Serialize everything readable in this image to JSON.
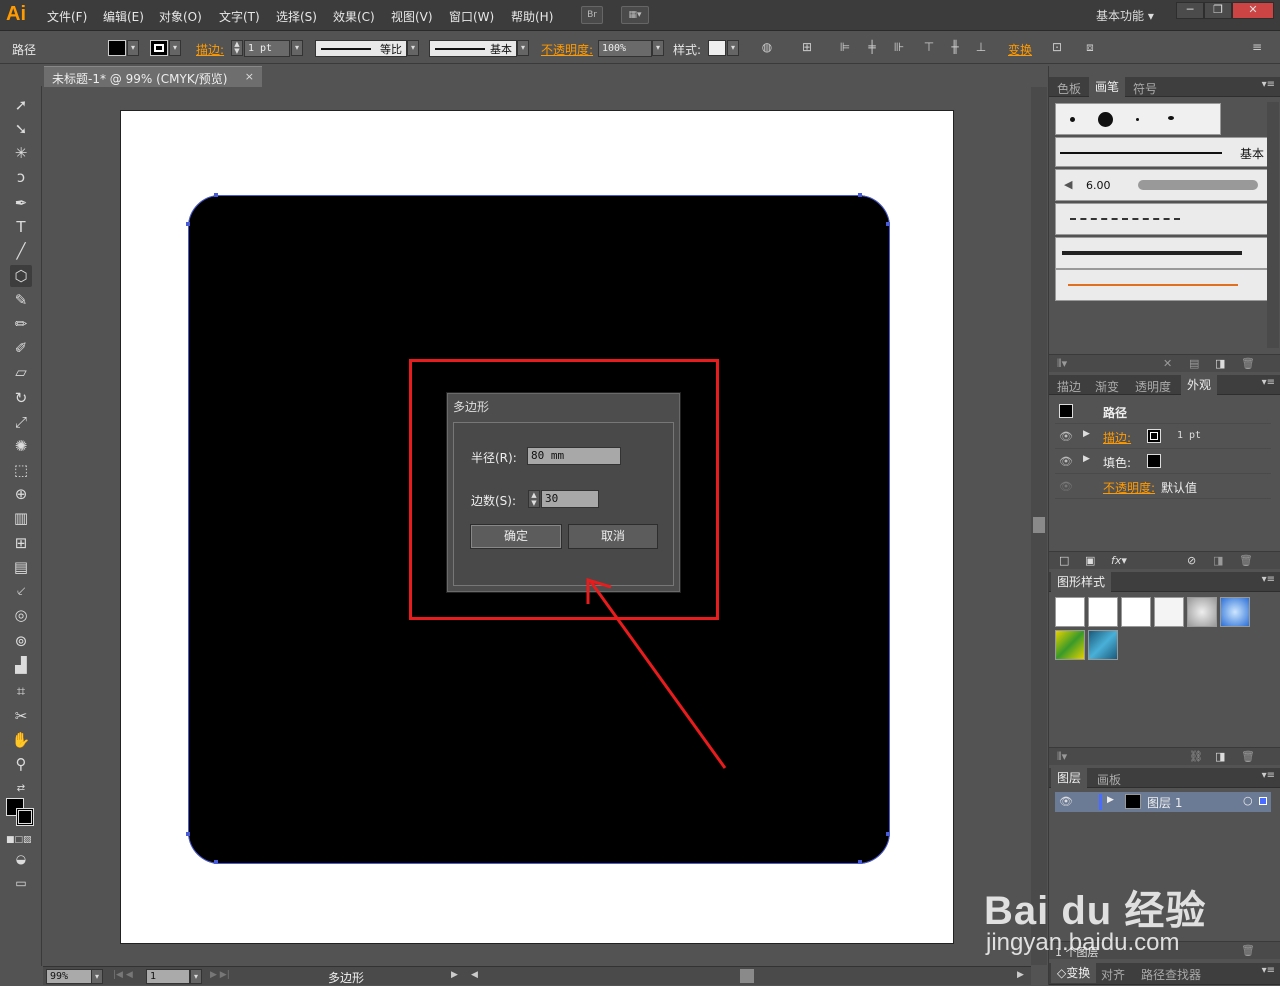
{
  "app": {
    "logo": "Ai",
    "workspace": "基本功能"
  },
  "menu": [
    "文件(F)",
    "编辑(E)",
    "对象(O)",
    "文字(T)",
    "选择(S)",
    "效果(C)",
    "视图(V)",
    "窗口(W)",
    "帮助(H)"
  ],
  "menubar_icons": {
    "bridge": "Br",
    "arrange": "arrange-documents-icon"
  },
  "window_buttons": {
    "minimize": "─",
    "restore": "❐",
    "close": "✕"
  },
  "control": {
    "selection_label": "路径",
    "stroke_label": "描边:",
    "stroke_weight": "1 pt",
    "profile_label": "等比",
    "brush_label": "基本",
    "opacity_label": "不透明度:",
    "opacity_value": "100%",
    "style_label": "样式:",
    "transform_label": "变换"
  },
  "document_tab": {
    "title": "未标题-1* @ 99% (CMYK/预览)",
    "close": "×"
  },
  "dialog": {
    "title": "多边形",
    "radius_label": "半径(R):",
    "radius_value": "80 mm",
    "sides_label": "边数(S):",
    "sides_value": "30",
    "ok": "确定",
    "cancel": "取消"
  },
  "status": {
    "zoom": "99%",
    "artboard": "1",
    "tool": "多边形"
  },
  "panels": {
    "top_tabs": [
      "色板",
      "画笔",
      "符号"
    ],
    "brushes": {
      "basic_label": "基本",
      "size_label": "6.00"
    },
    "appearance_tabs": [
      "描边",
      "渐变",
      "透明度",
      "外观"
    ],
    "appearance": {
      "title": "路径",
      "stroke_label": "描边:",
      "stroke_value": "1 pt",
      "fill_label": "填色:",
      "opacity_label": "不透明度:",
      "opacity_value": "默认值"
    },
    "graphic_styles_tab": "图形样式",
    "layers_tabs": [
      "图层",
      "画板"
    ],
    "layer": {
      "name": "图层 1",
      "count": "1 个图层"
    },
    "bottom_tabs": [
      "◇变换",
      "对齐",
      "路径查找器"
    ]
  },
  "watermark": {
    "brand": "Bai du 经验",
    "url": "jingyan.baidu.com"
  },
  "colors": {
    "accent": "#ff9a00",
    "annotation": "#e81c1c",
    "path_outline": "#4a5bd6"
  }
}
